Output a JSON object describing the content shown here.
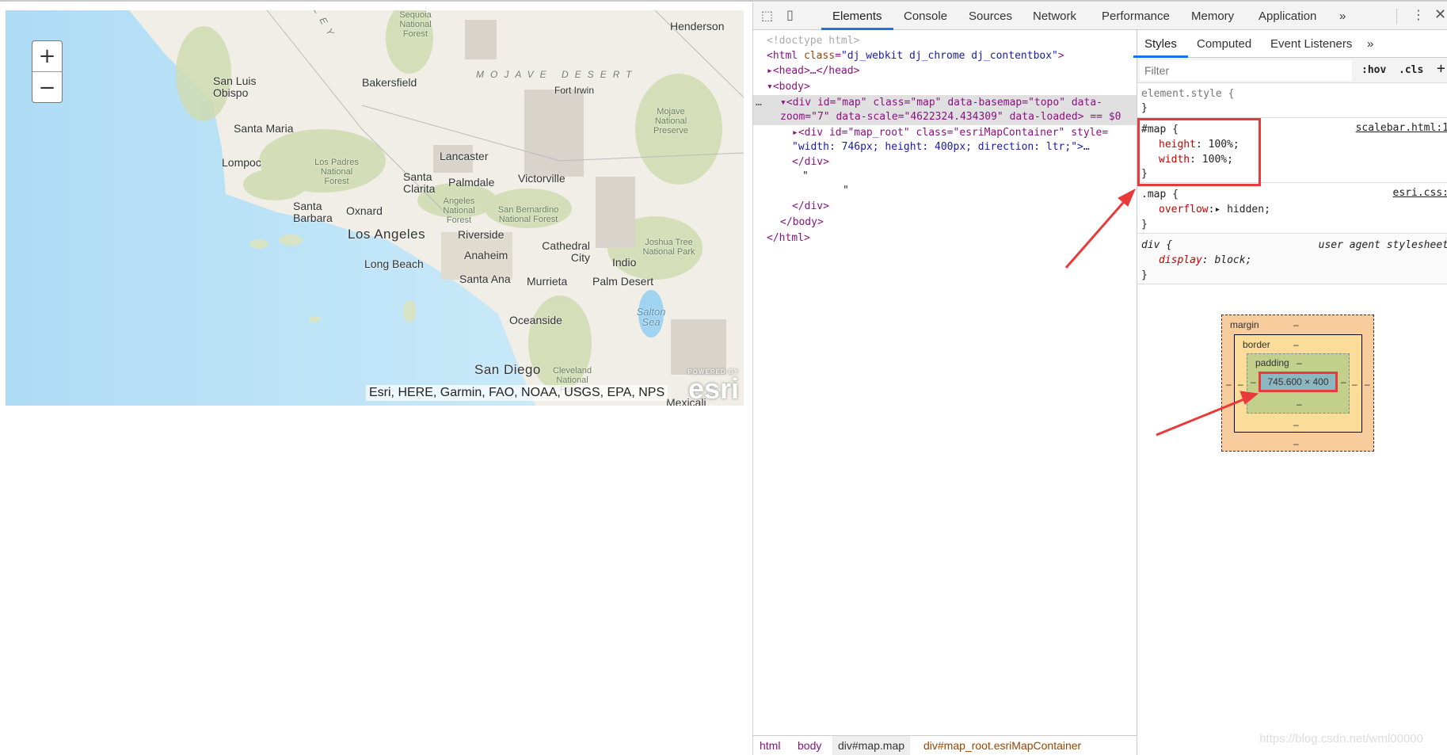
{
  "map": {
    "zoom_in": "+",
    "zoom_out": "−",
    "places": {
      "henderson": "Henderson",
      "bakersfield": "Bakersfield",
      "san_luis_obispo": "San Luis Obispo",
      "santa_maria": "Santa Maria",
      "lompoc": "Lompoc",
      "santa_barbara": "Santa Barbara",
      "oxnard": "Oxnard",
      "lancaster": "Lancaster",
      "santa_clarita": "Santa Clarita",
      "palmdale": "Palmdale",
      "victorville": "Victorville",
      "los_angeles": "Los Angeles",
      "riverside": "Riverside",
      "anaheim": "Anaheim",
      "long_beach": "Long Beach",
      "santa_ana": "Santa Ana",
      "murrieta": "Murrieta",
      "cathedral_city": "Cathedral City",
      "indio": "Indio",
      "palm_desert": "Palm Desert",
      "oceanside": "Oceanside",
      "san_diego": "San Diego",
      "fort_irwin": "Fort Irwin",
      "mexicali": "Mexicali"
    },
    "regions": {
      "mojave": "MOJAVE DESERT",
      "valley": "LEY",
      "mojave_preserve": "Mojave National Preserve",
      "joshua_tree": "Joshua Tree National Park",
      "los_padres": "Los Padres National Forest",
      "angeles": "Angeles National Forest",
      "san_bernardino": "San Bernardino National Forest",
      "cleveland": "Cleveland National Forest",
      "sequoia": "Sequoia National Forest",
      "salton_sea": "Salton Sea"
    },
    "attribution": "Esri, HERE, Garmin, FAO, NOAA, USGS, EPA, NPS",
    "logo_powered": "POWERED BY",
    "logo": "esri"
  },
  "devtools": {
    "tabs": [
      "Elements",
      "Console",
      "Sources",
      "Network",
      "Performance",
      "Memory",
      "Application"
    ],
    "more": "»",
    "dom": {
      "doctype": "<!doctype html>",
      "html_open": "<html ",
      "html_class_attr": "class",
      "html_class_val": "\"dj_webkit dj_chrome dj_contentbox\"",
      "head": "<head>…</head>",
      "body_open": "<body>",
      "div_map_1": "<div id=\"map\" class=\"map\" data-basemap=\"topo\" data-",
      "div_map_2": "zoom=\"7\" data-scale=\"4622324.434309\" data-loaded> == $0",
      "div_root_1": "<div id=\"map_root\" class=\"esriMapContainer\" style=",
      "div_root_2": "\"width: 746px; height: 400px; direction: ltr;\">…",
      "div_close": "</div>",
      "quote1": "\"",
      "quote2": "\"",
      "div_close2": "</div>",
      "body_close": "</body>",
      "html_close": "</html>"
    },
    "breadcrumbs": [
      "html",
      "body",
      "div#map.map",
      "div#map_root.esriMapContainer"
    ],
    "styles": {
      "tabs": [
        "Styles",
        "Computed",
        "Event Listeners"
      ],
      "more": "»",
      "filter_placeholder": "Filter",
      "hov": ":hov",
      "cls": ".cls",
      "add": "+",
      "element_style": "element.style {",
      "close": "}",
      "map_rule": {
        "selector": "#map {",
        "source": "scalebar.html:1",
        "props": [
          [
            "height",
            "100%;"
          ],
          [
            "width",
            "100%;"
          ]
        ]
      },
      "class_rule": {
        "selector": ".map {",
        "source": "esri.css:",
        "prop": "overflow",
        "value": "hidden;"
      },
      "ua_rule": {
        "selector": "div {",
        "source": "user agent stylesheet",
        "prop": "display",
        "value": "block;"
      }
    },
    "box_model": {
      "margin": "margin",
      "border": "border",
      "padding": "padding",
      "dash": "–",
      "content": "745.600 × 400"
    }
  },
  "watermark": "https://blog.csdn.net/wml00000",
  "colors": {
    "accent": "#1a73e8",
    "highlight": "#e83a3a",
    "ocean": "#b9e3f7",
    "land": "#f1efe8",
    "forest": "#cddbb0"
  }
}
